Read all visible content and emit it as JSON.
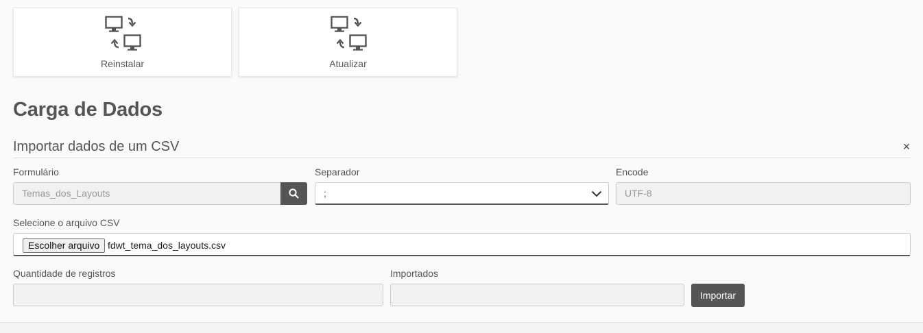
{
  "actions": [
    {
      "label": "Reinstalar",
      "icon": "sync-computers-icon"
    },
    {
      "label": "Atualizar",
      "icon": "sync-computers-icon"
    }
  ],
  "page": {
    "title": "Carga de Dados"
  },
  "section": {
    "title": "Importar dados de um CSV",
    "close_symbol": "×"
  },
  "form": {
    "formulario": {
      "label": "Formulário",
      "value": "Temas_dos_Layouts"
    },
    "separador": {
      "label": "Separador",
      "value": ";"
    },
    "encode": {
      "label": "Encode",
      "value": "UTF-8"
    },
    "arquivo": {
      "label": "Selecione o arquivo CSV",
      "button_label": "Escolher arquivo",
      "file_name": "fdwt_tema_dos_layouts.csv"
    },
    "quantidade": {
      "label": "Quantidade de registros",
      "value": ""
    },
    "importados": {
      "label": "Importados",
      "value": ""
    },
    "import_button": "Importar"
  },
  "colors": {
    "accent": "#555555",
    "background": "#fafafc"
  }
}
